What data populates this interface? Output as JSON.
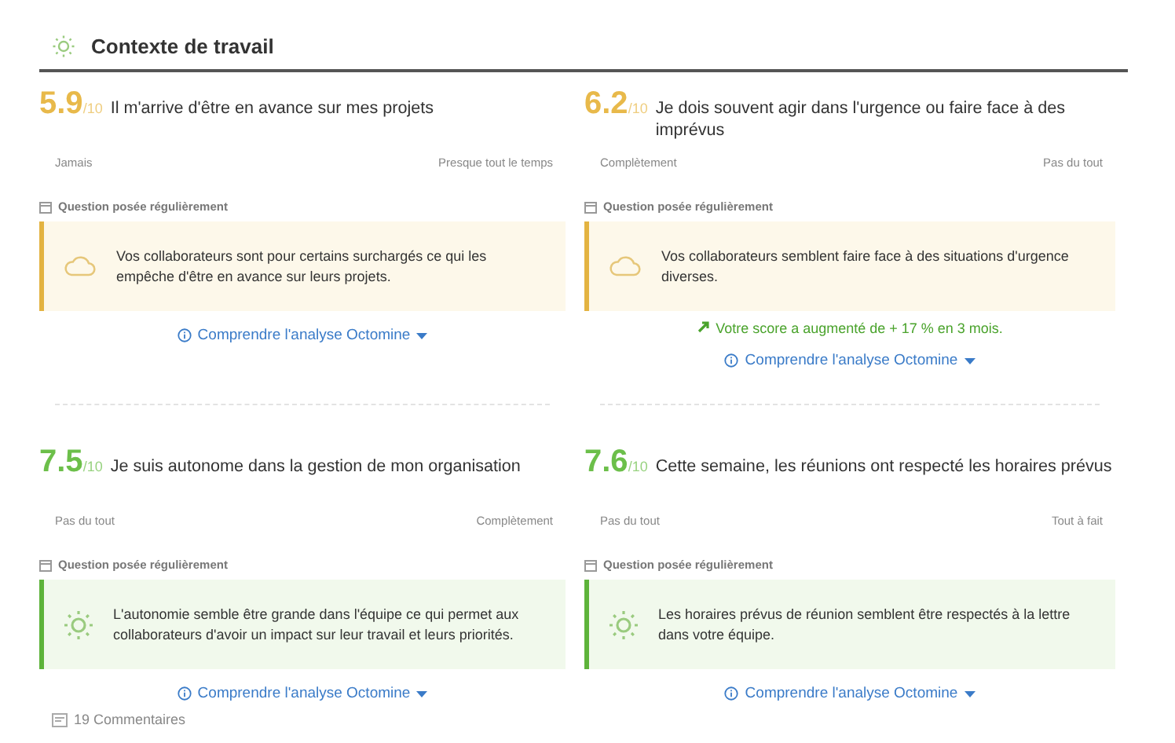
{
  "section": {
    "title": "Contexte de travail"
  },
  "cards": [
    {
      "score": "5.9",
      "scale": "/10",
      "question": "Il m'arrive d'être en avance sur mes projets",
      "scale_min": "Jamais",
      "scale_max": "Presque tout le temps",
      "frequency": "Question posée régulièrement",
      "kind": "warning",
      "insight": "Vos collaborateurs sont pour certains surchargés ce qui les empêche d'être en avance sur leurs projets.",
      "link": "Comprendre l'analyse Octomine"
    },
    {
      "score": "6.2",
      "scale": "/10",
      "question": "Je dois souvent agir dans l'urgence ou faire face à des imprévus",
      "scale_min": "Complètement",
      "scale_max": "Pas du tout",
      "frequency": "Question posée régulièrement",
      "kind": "warning",
      "insight": "Vos collaborateurs semblent faire face à des situations d'urgence diverses.",
      "trend": "Votre score a augmenté de + 17 % en 3 mois.",
      "link": "Comprendre l'analyse Octomine"
    },
    {
      "score": "7.5",
      "scale": "/10",
      "question": "Je suis autonome dans la gestion de mon organisation",
      "scale_min": "Pas du tout",
      "scale_max": "Complètement",
      "frequency": "Question posée régulièrement",
      "kind": "positive",
      "insight": "L'autonomie semble être grande dans l'équipe ce qui permet aux collaborateurs d'avoir un impact sur leur travail et leurs priorités.",
      "link": "Comprendre l'analyse Octomine",
      "comments": "19 Commentaires"
    },
    {
      "score": "7.6",
      "scale": "/10",
      "question": "Cette semaine, les réunions ont respecté les horaires prévus",
      "scale_min": "Pas du tout",
      "scale_max": "Tout à fait",
      "frequency": "Question posée régulièrement",
      "kind": "positive",
      "insight": "Les horaires prévus de réunion semblent être respectés à la lettre dans votre équipe.",
      "link": "Comprendre l'analyse Octomine"
    }
  ]
}
